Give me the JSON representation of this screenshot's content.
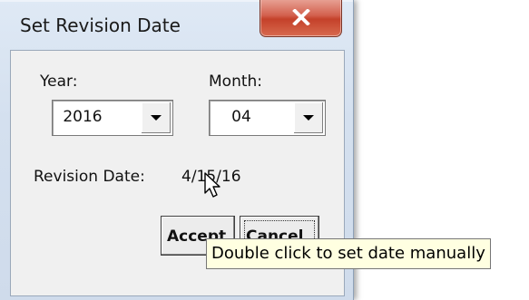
{
  "dialog": {
    "title": "Set Revision Date",
    "close_icon": "close-icon"
  },
  "year": {
    "label": "Year:",
    "value": "2016"
  },
  "month": {
    "label": "Month:",
    "value": "04"
  },
  "revision": {
    "label": "Revision Date:",
    "value": "4/15/16"
  },
  "buttons": {
    "accept_label": "Accept",
    "cancel_label": "Cancel"
  },
  "tooltip": {
    "text": "Double click to set date manually"
  },
  "colors": {
    "close_button": "#c4412a",
    "tooltip_bg": "#ffffe1"
  }
}
